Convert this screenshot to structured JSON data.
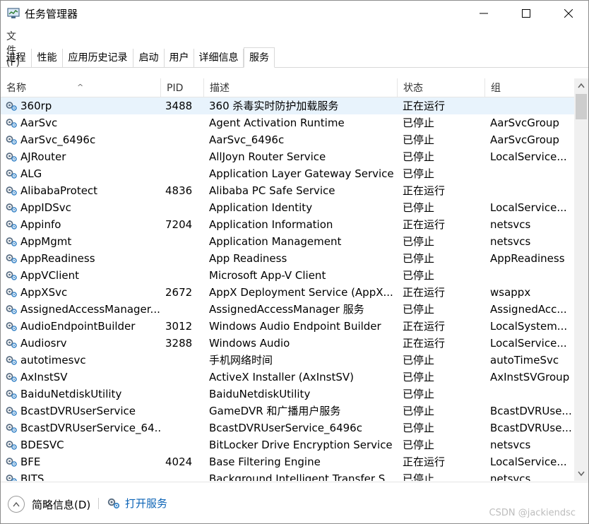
{
  "window": {
    "title": "任务管理器"
  },
  "menu": {
    "file": "文件(F)"
  },
  "tabs": [
    "进程",
    "性能",
    "应用历史记录",
    "启动",
    "用户",
    "详细信息",
    "服务"
  ],
  "columns": {
    "name": "名称",
    "pid": "PID",
    "desc": "描述",
    "status": "状态",
    "group": "组"
  },
  "services": [
    {
      "name": "360rp",
      "pid": "3488",
      "desc": "360 杀毒实时防护加载服务",
      "status": "正在运行",
      "group": ""
    },
    {
      "name": "AarSvc",
      "pid": "",
      "desc": "Agent Activation Runtime",
      "status": "已停止",
      "group": "AarSvcGroup"
    },
    {
      "name": "AarSvc_6496c",
      "pid": "",
      "desc": "AarSvc_6496c",
      "status": "已停止",
      "group": "AarSvcGroup"
    },
    {
      "name": "AJRouter",
      "pid": "",
      "desc": "AllJoyn Router Service",
      "status": "已停止",
      "group": "LocalService..."
    },
    {
      "name": "ALG",
      "pid": "",
      "desc": "Application Layer Gateway Service",
      "status": "已停止",
      "group": ""
    },
    {
      "name": "AlibabaProtect",
      "pid": "4836",
      "desc": "Alibaba PC Safe Service",
      "status": "正在运行",
      "group": ""
    },
    {
      "name": "AppIDSvc",
      "pid": "",
      "desc": "Application Identity",
      "status": "已停止",
      "group": "LocalService..."
    },
    {
      "name": "Appinfo",
      "pid": "7204",
      "desc": "Application Information",
      "status": "正在运行",
      "group": "netsvcs"
    },
    {
      "name": "AppMgmt",
      "pid": "",
      "desc": "Application Management",
      "status": "已停止",
      "group": "netsvcs"
    },
    {
      "name": "AppReadiness",
      "pid": "",
      "desc": "App Readiness",
      "status": "已停止",
      "group": "AppReadiness"
    },
    {
      "name": "AppVClient",
      "pid": "",
      "desc": "Microsoft App-V Client",
      "status": "已停止",
      "group": ""
    },
    {
      "name": "AppXSvc",
      "pid": "2672",
      "desc": "AppX Deployment Service (AppX...",
      "status": "正在运行",
      "group": "wsappx"
    },
    {
      "name": "AssignedAccessManager...",
      "pid": "",
      "desc": "AssignedAccessManager 服务",
      "status": "已停止",
      "group": "AssignedAcc..."
    },
    {
      "name": "AudioEndpointBuilder",
      "pid": "3012",
      "desc": "Windows Audio Endpoint Builder",
      "status": "正在运行",
      "group": "LocalSystem..."
    },
    {
      "name": "Audiosrv",
      "pid": "3288",
      "desc": "Windows Audio",
      "status": "正在运行",
      "group": "LocalService..."
    },
    {
      "name": "autotimesvc",
      "pid": "",
      "desc": "手机网络时间",
      "status": "已停止",
      "group": "autoTimeSvc"
    },
    {
      "name": "AxInstSV",
      "pid": "",
      "desc": "ActiveX Installer (AxInstSV)",
      "status": "已停止",
      "group": "AxInstSVGroup"
    },
    {
      "name": "BaiduNetdiskUtility",
      "pid": "",
      "desc": "BaiduNetdiskUtility",
      "status": "已停止",
      "group": ""
    },
    {
      "name": "BcastDVRUserService",
      "pid": "",
      "desc": "GameDVR 和广播用户服务",
      "status": "已停止",
      "group": "BcastDVRUse..."
    },
    {
      "name": "BcastDVRUserService_64...",
      "pid": "",
      "desc": "BcastDVRUserService_6496c",
      "status": "已停止",
      "group": "BcastDVRUse..."
    },
    {
      "name": "BDESVC",
      "pid": "",
      "desc": "BitLocker Drive Encryption Service",
      "status": "已停止",
      "group": "netsvcs"
    },
    {
      "name": "BFE",
      "pid": "4024",
      "desc": "Base Filtering Engine",
      "status": "正在运行",
      "group": "LocalService..."
    },
    {
      "name": "BITS",
      "pid": "",
      "desc": "Background Intelligent Transfer S...",
      "status": "已停止",
      "group": "netsvcs"
    }
  ],
  "footer": {
    "less_details": "简略信息(D)",
    "open_services": "打开服务",
    "watermark": "CSDN @jackiendsc"
  },
  "colors": {
    "selected_row": "#e8f3fc",
    "link": "#0b63b6"
  }
}
